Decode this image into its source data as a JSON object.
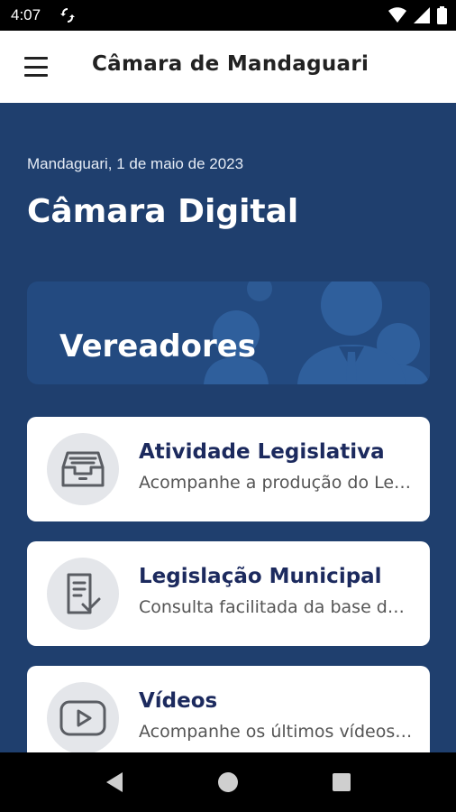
{
  "status_bar": {
    "time": "4:07",
    "left_icon": "sync-icon",
    "right_icons": [
      "wifi-icon",
      "signal-icon",
      "battery-icon"
    ]
  },
  "app_bar": {
    "menu_icon": "hamburger-menu-icon",
    "title": "Câmara de Mandaguari"
  },
  "header": {
    "date": "Mandaguari, 1 de maio de 2023",
    "title": "Câmara Digital"
  },
  "banner": {
    "label": "Vereadores",
    "illustration": "people-group-icon"
  },
  "cards": [
    {
      "title": "Atividade Legislativa",
      "subtitle": "Acompanhe a produção do Legislativo",
      "icon": "inbox-tray-icon"
    },
    {
      "title": "Legislação Municipal",
      "subtitle": "Consulta facilitada da base de dados",
      "icon": "document-check-icon"
    },
    {
      "title": "Vídeos",
      "subtitle": "Acompanhe os últimos vídeos publicados",
      "icon": "video-play-icon"
    }
  ],
  "nav_bar": {
    "buttons": [
      "back-icon",
      "home-icon",
      "recents-icon"
    ]
  },
  "colors": {
    "background": "#1f3f6e",
    "banner": "#234a80",
    "card_title": "#1c2a5e",
    "card_icon_bg": "#e4e6ea"
  }
}
